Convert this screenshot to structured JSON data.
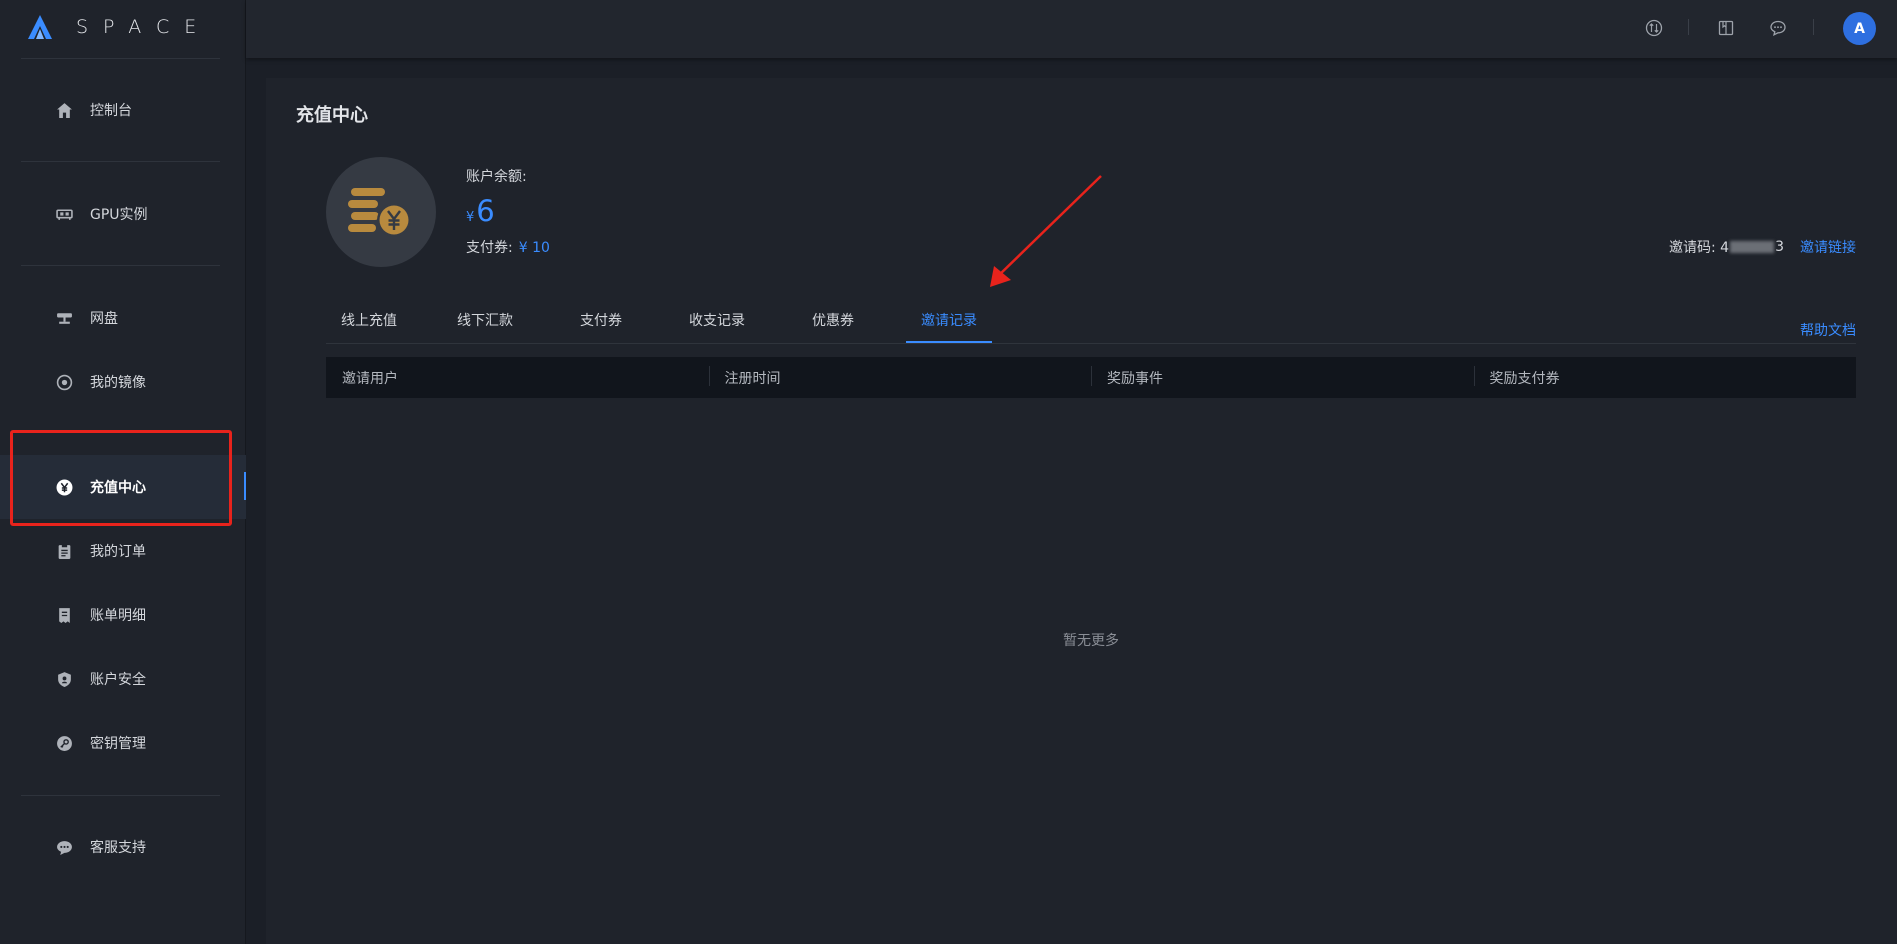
{
  "brand": {
    "name": "SPACE",
    "accent": "#3a8cff"
  },
  "sidebar": {
    "items": [
      {
        "label": "控制台",
        "icon": "home-icon"
      },
      {
        "label": "GPU实例",
        "icon": "gpu-icon"
      },
      {
        "label": "网盘",
        "icon": "storage-icon"
      },
      {
        "label": "我的镜像",
        "icon": "image-disc-icon"
      },
      {
        "label": "充值中心",
        "icon": "yen-icon",
        "active": true
      },
      {
        "label": "我的订单",
        "icon": "clipboard-icon"
      },
      {
        "label": "账单明细",
        "icon": "receipt-icon"
      },
      {
        "label": "账户安全",
        "icon": "shield-icon"
      },
      {
        "label": "密钥管理",
        "icon": "key-icon"
      },
      {
        "label": "客服支持",
        "icon": "chat-icon"
      }
    ]
  },
  "header": {
    "icons": [
      "transfer-icon",
      "book-icon",
      "message-icon"
    ],
    "avatar_letter": "A"
  },
  "page": {
    "title": "充值中心",
    "balance_label": "账户余额:",
    "currency_symbol": "¥",
    "balance_value": "6",
    "voucher_label": "支付券:",
    "voucher_value": "¥ 10",
    "invite_code_label": "邀请码: 4",
    "invite_code_suffix": "3",
    "invite_link": "邀请链接",
    "help_doc": "帮助文档"
  },
  "tabs": [
    {
      "label": "线上充值"
    },
    {
      "label": "线下汇款"
    },
    {
      "label": "支付券"
    },
    {
      "label": "收支记录"
    },
    {
      "label": "优惠券"
    },
    {
      "label": "邀请记录",
      "active": true
    }
  ],
  "table": {
    "columns": [
      "邀请用户",
      "注册时间",
      "奖励事件",
      "奖励支付券"
    ],
    "rows": [],
    "empty_text": "暂无更多"
  },
  "colors": {
    "annotation": "#e8231c",
    "background": "#1b1f27",
    "panel": "#1f232b"
  }
}
